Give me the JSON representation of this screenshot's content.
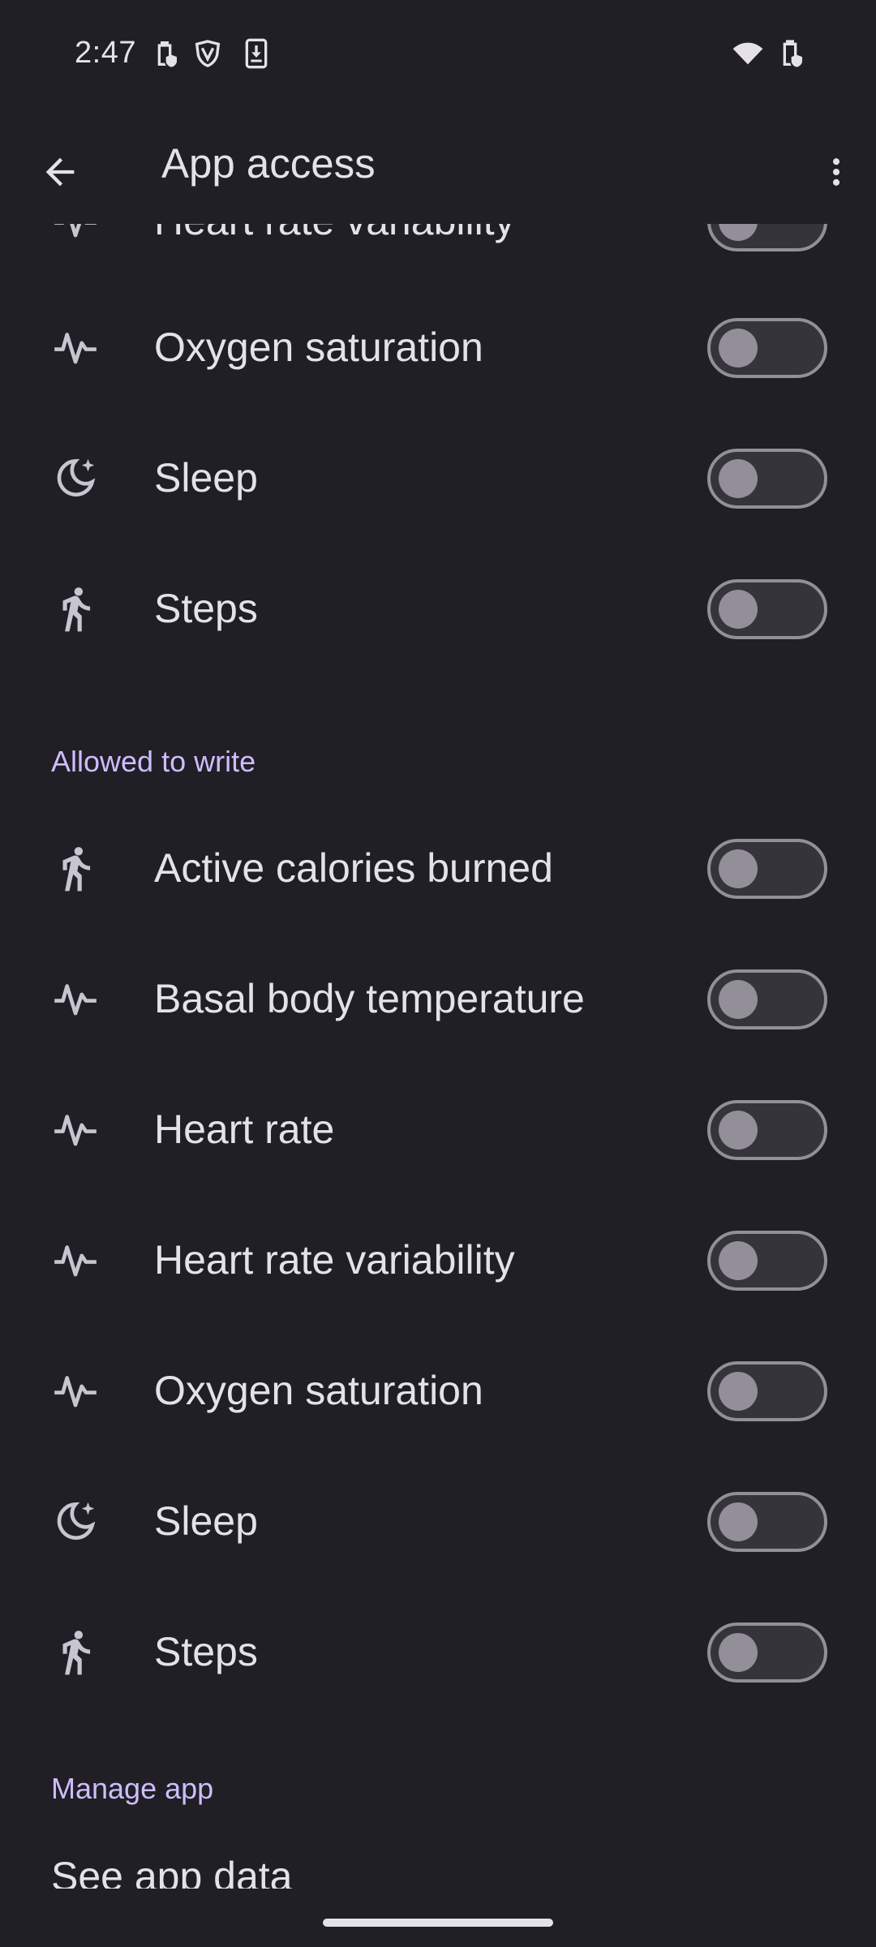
{
  "status_bar": {
    "time": "2:47",
    "left_icons": [
      "battery-saver-icon",
      "vpn-shield-icon",
      "download-icon"
    ],
    "right_icons": [
      "wifi-icon",
      "battery-charging-icon"
    ]
  },
  "app_bar": {
    "title": "App access",
    "back_icon": "arrow-back-icon",
    "more_icon": "more-vertical-icon"
  },
  "read_items": [
    {
      "label": "Heart rate variability",
      "icon": "vitals-icon",
      "enabled": false
    },
    {
      "label": "Oxygen saturation",
      "icon": "vitals-icon",
      "enabled": false
    },
    {
      "label": "Sleep",
      "icon": "sleep-moon-icon",
      "enabled": false
    },
    {
      "label": "Steps",
      "icon": "directions-run-icon",
      "enabled": false
    }
  ],
  "write_section": {
    "header": "Allowed to write",
    "items": [
      {
        "label": "Active calories burned",
        "icon": "directions-run-icon",
        "enabled": false
      },
      {
        "label": "Basal body temperature",
        "icon": "vitals-icon",
        "enabled": false
      },
      {
        "label": "Heart rate",
        "icon": "vitals-icon",
        "enabled": false
      },
      {
        "label": "Heart rate variability",
        "icon": "vitals-icon",
        "enabled": false
      },
      {
        "label": "Oxygen saturation",
        "icon": "vitals-icon",
        "enabled": false
      },
      {
        "label": "Sleep",
        "icon": "sleep-moon-icon",
        "enabled": false
      },
      {
        "label": "Steps",
        "icon": "directions-run-icon",
        "enabled": false
      }
    ]
  },
  "manage_section": {
    "header": "Manage app",
    "first_item": "See app data"
  },
  "colors": {
    "background": "#201f25",
    "text": "#e5e1e9",
    "accent": "#cdbdff",
    "toggle_outline": "#928f99",
    "toggle_track": "#36343b"
  }
}
